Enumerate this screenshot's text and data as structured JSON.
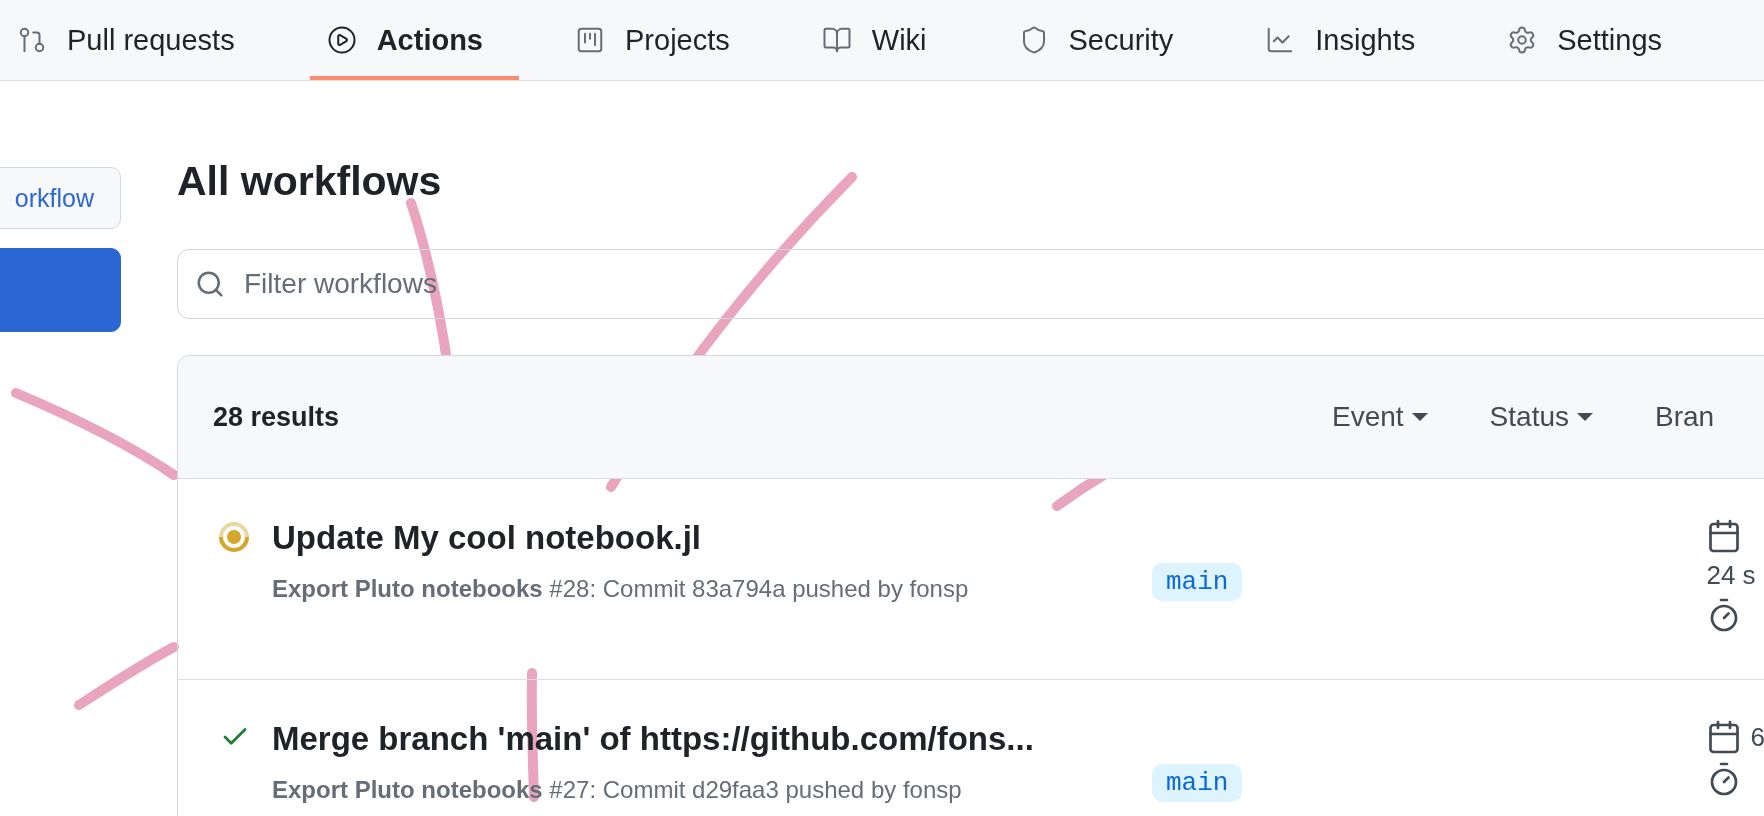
{
  "nav": {
    "tabs": [
      {
        "kind": "pull-request",
        "label": "Pull requests",
        "selected": false
      },
      {
        "kind": "play",
        "label": "Actions",
        "selected": true
      },
      {
        "kind": "projects",
        "label": "Projects",
        "selected": false
      },
      {
        "kind": "book",
        "label": "Wiki",
        "selected": false
      },
      {
        "kind": "shield",
        "label": "Security",
        "selected": false
      },
      {
        "kind": "chart",
        "label": "Insights",
        "selected": false
      },
      {
        "kind": "gear",
        "label": "Settings",
        "selected": false
      }
    ]
  },
  "sidebar": {
    "buttons": [
      {
        "kind": "outline",
        "label": "orkflow"
      },
      {
        "kind": "primary"
      }
    ]
  },
  "heading": "All workflows",
  "filter": {
    "placeholder": "Filter workflows"
  },
  "results": {
    "count": "28 results",
    "filters": [
      {
        "label": "Event",
        "caret": true
      },
      {
        "label": "Status",
        "caret": true
      },
      {
        "label": "Bran",
        "caret": false
      }
    ]
  },
  "runs": [
    {
      "kind": "in_progress",
      "title": "Update My cool notebook.jl",
      "subtitle": "**Export Pluto notebooks** #28: Commit 83a794a pushed by fonsp",
      "branch": "main",
      "date": "24 s"
    },
    {
      "kind": "success",
      "title": "Merge branch 'main' of https://github.com/fons...",
      "subtitle": "**Export Pluto notebooks** #27: Commit d29faa3 pushed by fonsp",
      "branch": "main",
      "date": "6"
    }
  ]
}
